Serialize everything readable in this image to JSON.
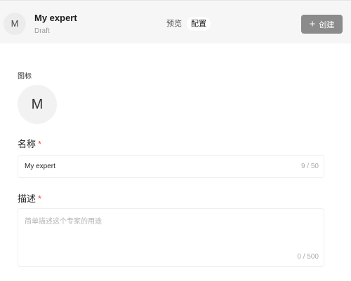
{
  "header": {
    "avatar_letter": "M",
    "expert_name": "My expert",
    "status": "Draft",
    "tabs": [
      {
        "label": "预览",
        "active": false
      },
      {
        "label": "配置",
        "active": true
      }
    ],
    "create_label": "创建"
  },
  "form": {
    "icon_label": "图标",
    "icon_letter": "M",
    "name_label": "名称",
    "required_mark": "*",
    "name_value": "My expert",
    "name_counter": "9 / 50",
    "description_label": "描述",
    "description_placeholder": "简单描述这个专家的用途",
    "description_value": "",
    "description_counter": "0 / 500"
  }
}
